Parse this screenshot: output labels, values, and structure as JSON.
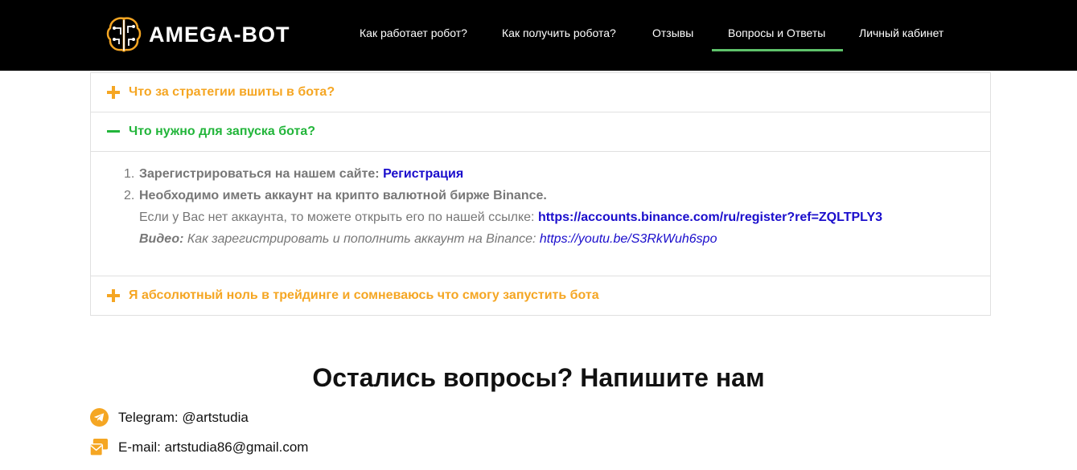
{
  "header": {
    "logo_text": "AMEGA-BOT",
    "nav": [
      {
        "label": "Как работает робот?"
      },
      {
        "label": "Как получить робота?"
      },
      {
        "label": "Отзывы"
      },
      {
        "label": "Вопросы и Ответы"
      },
      {
        "label": "Личный кабинет"
      }
    ]
  },
  "faq": {
    "items": [
      {
        "question": "Что за стратегии вшиты в бота?"
      },
      {
        "question": "Что нужно для запуска бота?"
      },
      {
        "question": "Я абсолютный ноль в трейдинге и сомневаюсь что смогу запустить бота"
      }
    ],
    "answer": {
      "step1_num": "1.",
      "step1_text": "Зарегистрироваться на нашем сайте: ",
      "step1_link": "Регистрация",
      "step2_num": "2.",
      "step2_text": "Необходимо иметь аккаунт на крипто валютной бирже Binance.",
      "step2_sub_text": "Если у Вас нет аккаунта, то можете открыть его по нашей ссылке: ",
      "step2_sub_link": "https://accounts.binance.com/ru/register?ref=ZQLTPLY3",
      "video_label": "Видео:",
      "video_text": " Как зарегистрировать и пополнить аккаунт на Binance: ",
      "video_link": "https://youtu.be/S3RkWuh6spo"
    }
  },
  "contact": {
    "title": "Остались вопросы? Напишите нам",
    "telegram": "Telegram: @artstudia",
    "email": "E-mail: artstudia86@gmail.com"
  },
  "colors": {
    "accent_orange": "#f5a623",
    "accent_green": "#22b53a",
    "link_blue": "#1a0dcc",
    "nav_underline": "#5ec26a"
  }
}
